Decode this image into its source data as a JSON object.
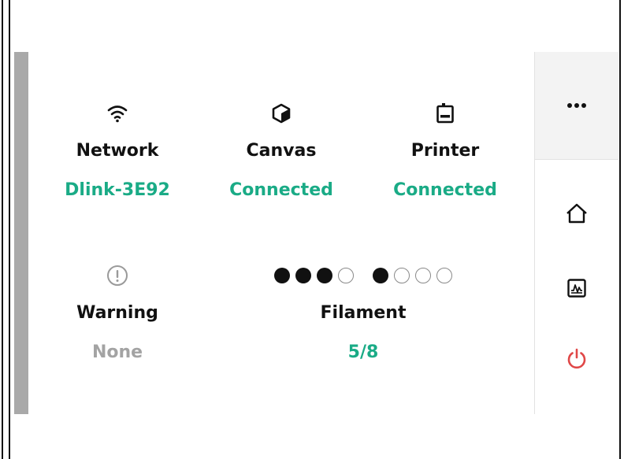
{
  "status": {
    "network": {
      "label": "Network",
      "value": "Dlink-3E92",
      "icon": "wifi-icon"
    },
    "canvas": {
      "label": "Canvas",
      "value": "Connected",
      "icon": "canvas-cube-icon"
    },
    "printer": {
      "label": "Printer",
      "value": "Connected",
      "icon": "printer-icon"
    },
    "warning": {
      "label": "Warning",
      "value": "None",
      "icon": "warning-circle-icon"
    },
    "filament": {
      "label": "Filament",
      "value": "5/8",
      "level": 0.625,
      "dots": [
        1,
        1,
        1,
        0,
        1,
        0,
        0,
        0
      ]
    }
  },
  "sidebar": {
    "items": [
      {
        "name": "more",
        "icon": "more-dots-icon"
      },
      {
        "name": "home",
        "icon": "home-icon"
      },
      {
        "name": "activity",
        "icon": "activity-chart-icon"
      },
      {
        "name": "power",
        "icon": "power-icon"
      }
    ]
  },
  "colors": {
    "accent": "#1aab86",
    "muted": "#a3a3a3",
    "power": "#e04848",
    "bar": "#a9a9a9"
  }
}
